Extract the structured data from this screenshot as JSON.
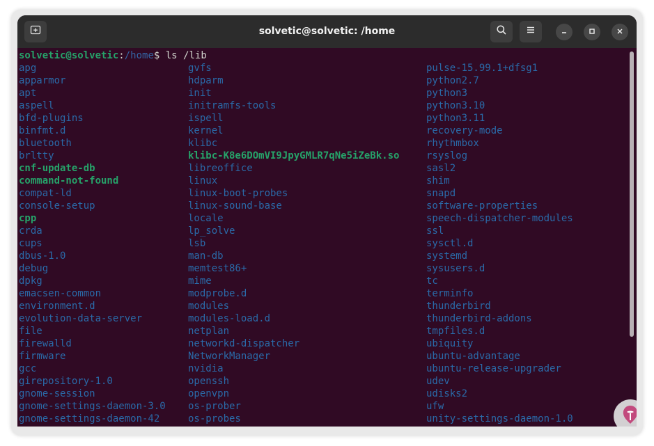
{
  "window": {
    "title": "solvetic@solvetic: /home"
  },
  "prompt": {
    "user_host": "solvetic@solvetic",
    "colon": ":",
    "path": "/home",
    "dollar": "$",
    "command": " ls /lib"
  },
  "columns": [
    [
      {
        "name": "apg",
        "type": "dir"
      },
      {
        "name": "apparmor",
        "type": "dir"
      },
      {
        "name": "apt",
        "type": "dir"
      },
      {
        "name": "aspell",
        "type": "dir"
      },
      {
        "name": "bfd-plugins",
        "type": "dir"
      },
      {
        "name": "binfmt.d",
        "type": "dir"
      },
      {
        "name": "bluetooth",
        "type": "dir"
      },
      {
        "name": "brltty",
        "type": "dir"
      },
      {
        "name": "cnf-update-db",
        "type": "exec"
      },
      {
        "name": "command-not-found",
        "type": "exec"
      },
      {
        "name": "compat-ld",
        "type": "dir"
      },
      {
        "name": "console-setup",
        "type": "dir"
      },
      {
        "name": "cpp",
        "type": "exec"
      },
      {
        "name": "crda",
        "type": "dir"
      },
      {
        "name": "cups",
        "type": "dir"
      },
      {
        "name": "dbus-1.0",
        "type": "dir"
      },
      {
        "name": "debug",
        "type": "dir"
      },
      {
        "name": "dpkg",
        "type": "dir"
      },
      {
        "name": "emacsen-common",
        "type": "dir"
      },
      {
        "name": "environment.d",
        "type": "dir"
      },
      {
        "name": "evolution-data-server",
        "type": "dir"
      },
      {
        "name": "file",
        "type": "dir"
      },
      {
        "name": "firewalld",
        "type": "dir"
      },
      {
        "name": "firmware",
        "type": "dir"
      },
      {
        "name": "gcc",
        "type": "dir"
      },
      {
        "name": "girepository-1.0",
        "type": "dir"
      },
      {
        "name": "gnome-session",
        "type": "dir"
      },
      {
        "name": "gnome-settings-daemon-3.0",
        "type": "dir"
      },
      {
        "name": "gnome-settings-daemon-42",
        "type": "dir"
      }
    ],
    [
      {
        "name": "gvfs",
        "type": "dir"
      },
      {
        "name": "hdparm",
        "type": "dir"
      },
      {
        "name": "init",
        "type": "dir"
      },
      {
        "name": "initramfs-tools",
        "type": "dir"
      },
      {
        "name": "ispell",
        "type": "dir"
      },
      {
        "name": "kernel",
        "type": "dir"
      },
      {
        "name": "klibc",
        "type": "dir"
      },
      {
        "name": "klibc-K8e6DOmVI9JpyGMLR7qNe5iZeBk.so",
        "type": "exec"
      },
      {
        "name": "libreoffice",
        "type": "dir"
      },
      {
        "name": "linux",
        "type": "dir"
      },
      {
        "name": "linux-boot-probes",
        "type": "dir"
      },
      {
        "name": "linux-sound-base",
        "type": "dir"
      },
      {
        "name": "locale",
        "type": "dir"
      },
      {
        "name": "lp_solve",
        "type": "dir"
      },
      {
        "name": "lsb",
        "type": "dir"
      },
      {
        "name": "man-db",
        "type": "dir"
      },
      {
        "name": "memtest86+",
        "type": "dir"
      },
      {
        "name": "mime",
        "type": "dir"
      },
      {
        "name": "modprobe.d",
        "type": "dir"
      },
      {
        "name": "modules",
        "type": "dir"
      },
      {
        "name": "modules-load.d",
        "type": "dir"
      },
      {
        "name": "netplan",
        "type": "dir"
      },
      {
        "name": "networkd-dispatcher",
        "type": "dir"
      },
      {
        "name": "NetworkManager",
        "type": "dir"
      },
      {
        "name": "nvidia",
        "type": "dir"
      },
      {
        "name": "openssh",
        "type": "dir"
      },
      {
        "name": "openvpn",
        "type": "dir"
      },
      {
        "name": "os-prober",
        "type": "dir"
      },
      {
        "name": "os-probes",
        "type": "dir"
      }
    ],
    [
      {
        "name": "pulse-15.99.1+dfsg1",
        "type": "dir"
      },
      {
        "name": "python2.7",
        "type": "dir"
      },
      {
        "name": "python3",
        "type": "dir"
      },
      {
        "name": "python3.10",
        "type": "dir"
      },
      {
        "name": "python3.11",
        "type": "dir"
      },
      {
        "name": "recovery-mode",
        "type": "dir"
      },
      {
        "name": "rhythmbox",
        "type": "dir"
      },
      {
        "name": "rsyslog",
        "type": "dir"
      },
      {
        "name": "sasl2",
        "type": "dir"
      },
      {
        "name": "shim",
        "type": "dir"
      },
      {
        "name": "snapd",
        "type": "dir"
      },
      {
        "name": "software-properties",
        "type": "dir"
      },
      {
        "name": "speech-dispatcher-modules",
        "type": "dir"
      },
      {
        "name": "ssl",
        "type": "dir"
      },
      {
        "name": "sysctl.d",
        "type": "dir"
      },
      {
        "name": "systemd",
        "type": "dir"
      },
      {
        "name": "sysusers.d",
        "type": "dir"
      },
      {
        "name": "tc",
        "type": "dir"
      },
      {
        "name": "terminfo",
        "type": "dir"
      },
      {
        "name": "thunderbird",
        "type": "dir"
      },
      {
        "name": "thunderbird-addons",
        "type": "dir"
      },
      {
        "name": "tmpfiles.d",
        "type": "dir"
      },
      {
        "name": "ubiquity",
        "type": "dir"
      },
      {
        "name": "ubuntu-advantage",
        "type": "dir"
      },
      {
        "name": "ubuntu-release-upgrader",
        "type": "dir"
      },
      {
        "name": "udev",
        "type": "dir"
      },
      {
        "name": "udisks2",
        "type": "dir"
      },
      {
        "name": "ufw",
        "type": "dir"
      },
      {
        "name": "unity-settings-daemon-1.0",
        "type": "dir"
      }
    ]
  ],
  "icons": {
    "new_tab": "new-tab-icon",
    "search": "search-icon",
    "menu": "hamburger-menu-icon",
    "minimize": "minimize-icon",
    "maximize": "maximize-icon",
    "close": "close-icon",
    "watermark": "solvetic-logo-icon"
  },
  "colors": {
    "terminal_bg": "#300a24",
    "titlebar_bg": "#2c2c2c",
    "directory": "#2a6aa8",
    "executable": "#26a269",
    "prompt_user": "#26a269",
    "prompt_path": "#3465a4"
  }
}
